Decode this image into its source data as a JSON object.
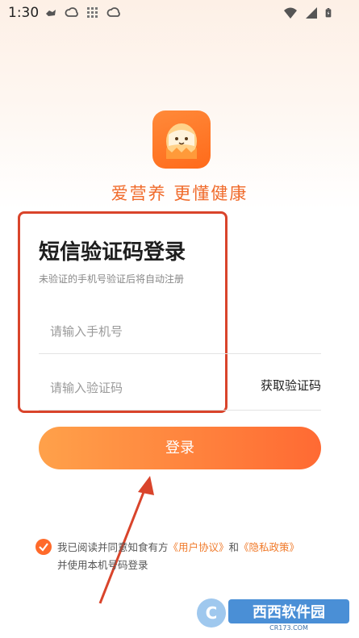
{
  "status_bar": {
    "time": "1:30"
  },
  "brand": {
    "slogan": "爱营养  更懂健康"
  },
  "login": {
    "title": "短信验证码登录",
    "subtitle": "未验证的手机号验证后将自动注册",
    "phone_placeholder": "请输入手机号",
    "code_placeholder": "请输入验证码",
    "get_code_label": "获取验证码",
    "submit_label": "登录"
  },
  "agreement": {
    "text_1": "我已阅读并同意知食有方",
    "user_agreement": "《用户协议》",
    "and": "和",
    "privacy_policy": "《隐私政策》",
    "text_2": "并使用本机号码登录",
    "checked": true
  },
  "watermark": {
    "main": "西西软件园",
    "sub": "CR173.COM"
  },
  "colors": {
    "accent": "#ff6a2a",
    "highlight_box": "#d9442b"
  }
}
